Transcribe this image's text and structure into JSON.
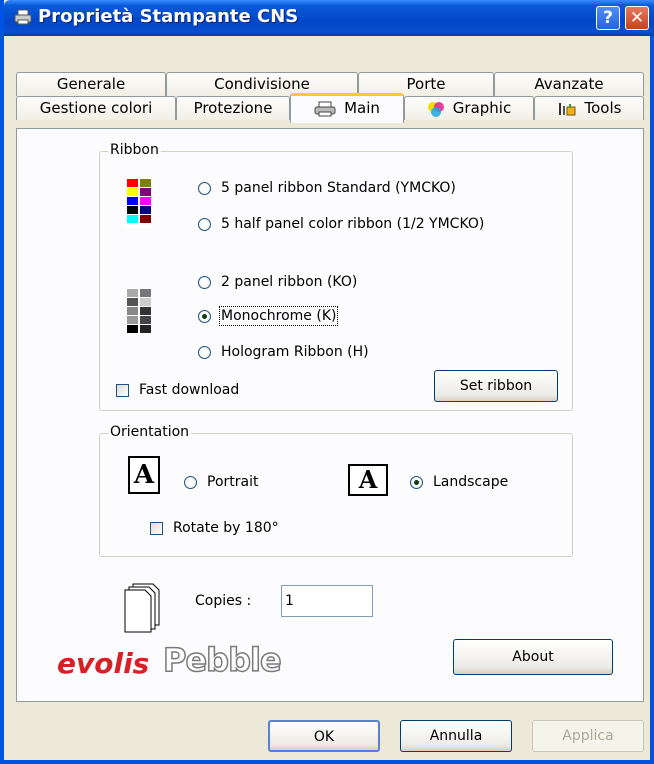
{
  "window": {
    "title": "Proprietà Stampante CNS"
  },
  "titlebar": {
    "help_label": "?",
    "close_label": "✕"
  },
  "tabs": {
    "row1": [
      "Generale",
      "Condivisione",
      "Porte",
      "Avanzate"
    ],
    "row2": [
      "Gestione colori",
      "Protezione",
      "Main",
      "Graphic",
      "Tools"
    ],
    "active": "Main"
  },
  "ribbon": {
    "legend": "Ribbon",
    "options": [
      {
        "label": "5 panel ribbon Standard (YMCKO)",
        "selected": false
      },
      {
        "label": "5 half panel color ribbon (1/2 YMCKO)",
        "selected": false
      },
      {
        "label": "2 panel ribbon (KO)",
        "selected": false
      },
      {
        "label": "Monochrome (K)",
        "selected": true
      },
      {
        "label": "Hologram Ribbon (H)",
        "selected": false
      }
    ],
    "fast_download_label": "Fast download",
    "fast_download_checked": false,
    "set_ribbon_label": "Set ribbon"
  },
  "orientation": {
    "legend": "Orientation",
    "portrait_label": "Portrait",
    "landscape_label": "Landscape",
    "selected": "Landscape",
    "icon_glyph": "A",
    "rotate_label": "Rotate by 180°",
    "rotate_checked": false
  },
  "copies": {
    "label": "Copies :",
    "value": "1"
  },
  "logo": {
    "brand": "evolis",
    "product": "Pebble"
  },
  "about_label": "About",
  "footer": {
    "ok_label": "OK",
    "cancel_label": "Annulla",
    "apply_label": "Applica"
  },
  "colors": {
    "title_bar": "#0a5ad8",
    "dialog_bg": "#ece9d8",
    "tab_highlight": "#ffc83c",
    "logo_red": "#d81f26"
  }
}
